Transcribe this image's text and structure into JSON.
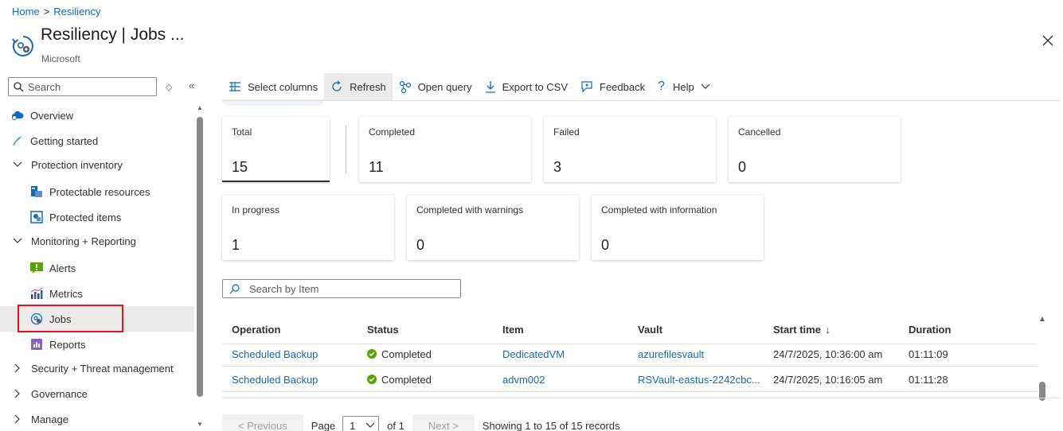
{
  "breadcrumb": {
    "home": "Home",
    "separator": ">",
    "current": "Resiliency"
  },
  "header": {
    "title": "Resiliency | Jobs ...",
    "subtitle": "Microsoft",
    "icon": "resiliency-gear-icon",
    "close_icon": "close-icon"
  },
  "sidebar": {
    "search_placeholder": "Search",
    "items": [
      {
        "label": "Overview",
        "icon": "cloud-icon"
      },
      {
        "label": "Getting started",
        "icon": "rocket-icon"
      },
      {
        "label": "Protection inventory",
        "chevron": "expanded"
      },
      {
        "label": "Protectable resources",
        "icon": "server-icon"
      },
      {
        "label": "Protected items",
        "icon": "protected-items-icon"
      },
      {
        "label": "Monitoring + Reporting",
        "chevron": "expanded"
      },
      {
        "label": "Alerts",
        "icon": "alert-icon"
      },
      {
        "label": "Metrics",
        "icon": "metrics-icon"
      },
      {
        "label": "Jobs",
        "icon": "jobs-icon",
        "selected": true
      },
      {
        "label": "Reports",
        "icon": "reports-icon"
      },
      {
        "label": "Security + Threat management",
        "chevron": "collapsed"
      },
      {
        "label": "Governance",
        "chevron": "collapsed"
      },
      {
        "label": "Manage",
        "chevron": "collapsed"
      }
    ]
  },
  "toolbar": {
    "select_columns": "Select columns",
    "refresh": "Refresh",
    "open_query": "Open query",
    "export_csv": "Export to CSV",
    "feedback": "Feedback",
    "help": "Help"
  },
  "summary": {
    "total": {
      "label": "Total",
      "value": "15"
    },
    "completed": {
      "label": "Completed",
      "value": "11"
    },
    "failed": {
      "label": "Failed",
      "value": "3"
    },
    "cancelled": {
      "label": "Cancelled",
      "value": "0"
    },
    "in_progress": {
      "label": "In progress",
      "value": "1"
    },
    "completed_warnings": {
      "label": "Completed with warnings",
      "value": "0"
    },
    "completed_info": {
      "label": "Completed with information",
      "value": "0"
    }
  },
  "item_search": {
    "placeholder": "Search by Item"
  },
  "table": {
    "columns": {
      "operation": "Operation",
      "status": "Status",
      "item": "Item",
      "vault": "Vault",
      "start_time": "Start time",
      "sort_indicator": "↓",
      "duration": "Duration"
    },
    "rows": [
      {
        "operation": "Scheduled Backup",
        "status": "Completed",
        "item": "DedicatedVM",
        "vault": "azurefilesvault",
        "start_time": "24/7/2025, 10:36:00 am",
        "duration": "01:11:09"
      },
      {
        "operation": "Scheduled Backup",
        "status": "Completed",
        "item": "advm002",
        "vault": "RSVault-eastus-2242cbc...",
        "start_time": "24/7/2025, 10:16:05 am",
        "duration": "01:11:28"
      }
    ]
  },
  "pagination": {
    "previous": "< Previous",
    "page_label": "Page",
    "page_value": "1",
    "of_label": "of 1",
    "next": "Next >",
    "showing": "Showing 1 to 15 of 15 records"
  },
  "colors": {
    "accent": "#0f6cbd",
    "success": "#57a300",
    "highlight": "#e81123"
  }
}
